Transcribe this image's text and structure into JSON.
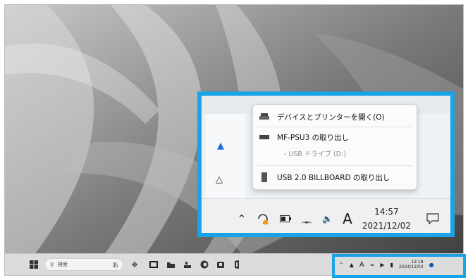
{
  "taskbar": {
    "search_placeholder": "検索",
    "search_badge": "あ"
  },
  "mini_tray": {
    "time": "12:18",
    "date": "2024/12/03",
    "ime_label": "A"
  },
  "context_menu": {
    "items": [
      {
        "label": "デバイスとプリンターを開く(O)"
      },
      {
        "label": "MF-PSU3 の取り出し"
      },
      {
        "label": "- USB ドライブ (D:)"
      },
      {
        "label": "USB 2.0 BILLBOARD の取り出し"
      }
    ]
  },
  "zoom_tray": {
    "ime_label": "A",
    "time": "14:57",
    "date": "2021/12/02"
  },
  "colors": {
    "highlight": "#1aa3e8",
    "taskbar": "#dcdcdc"
  }
}
